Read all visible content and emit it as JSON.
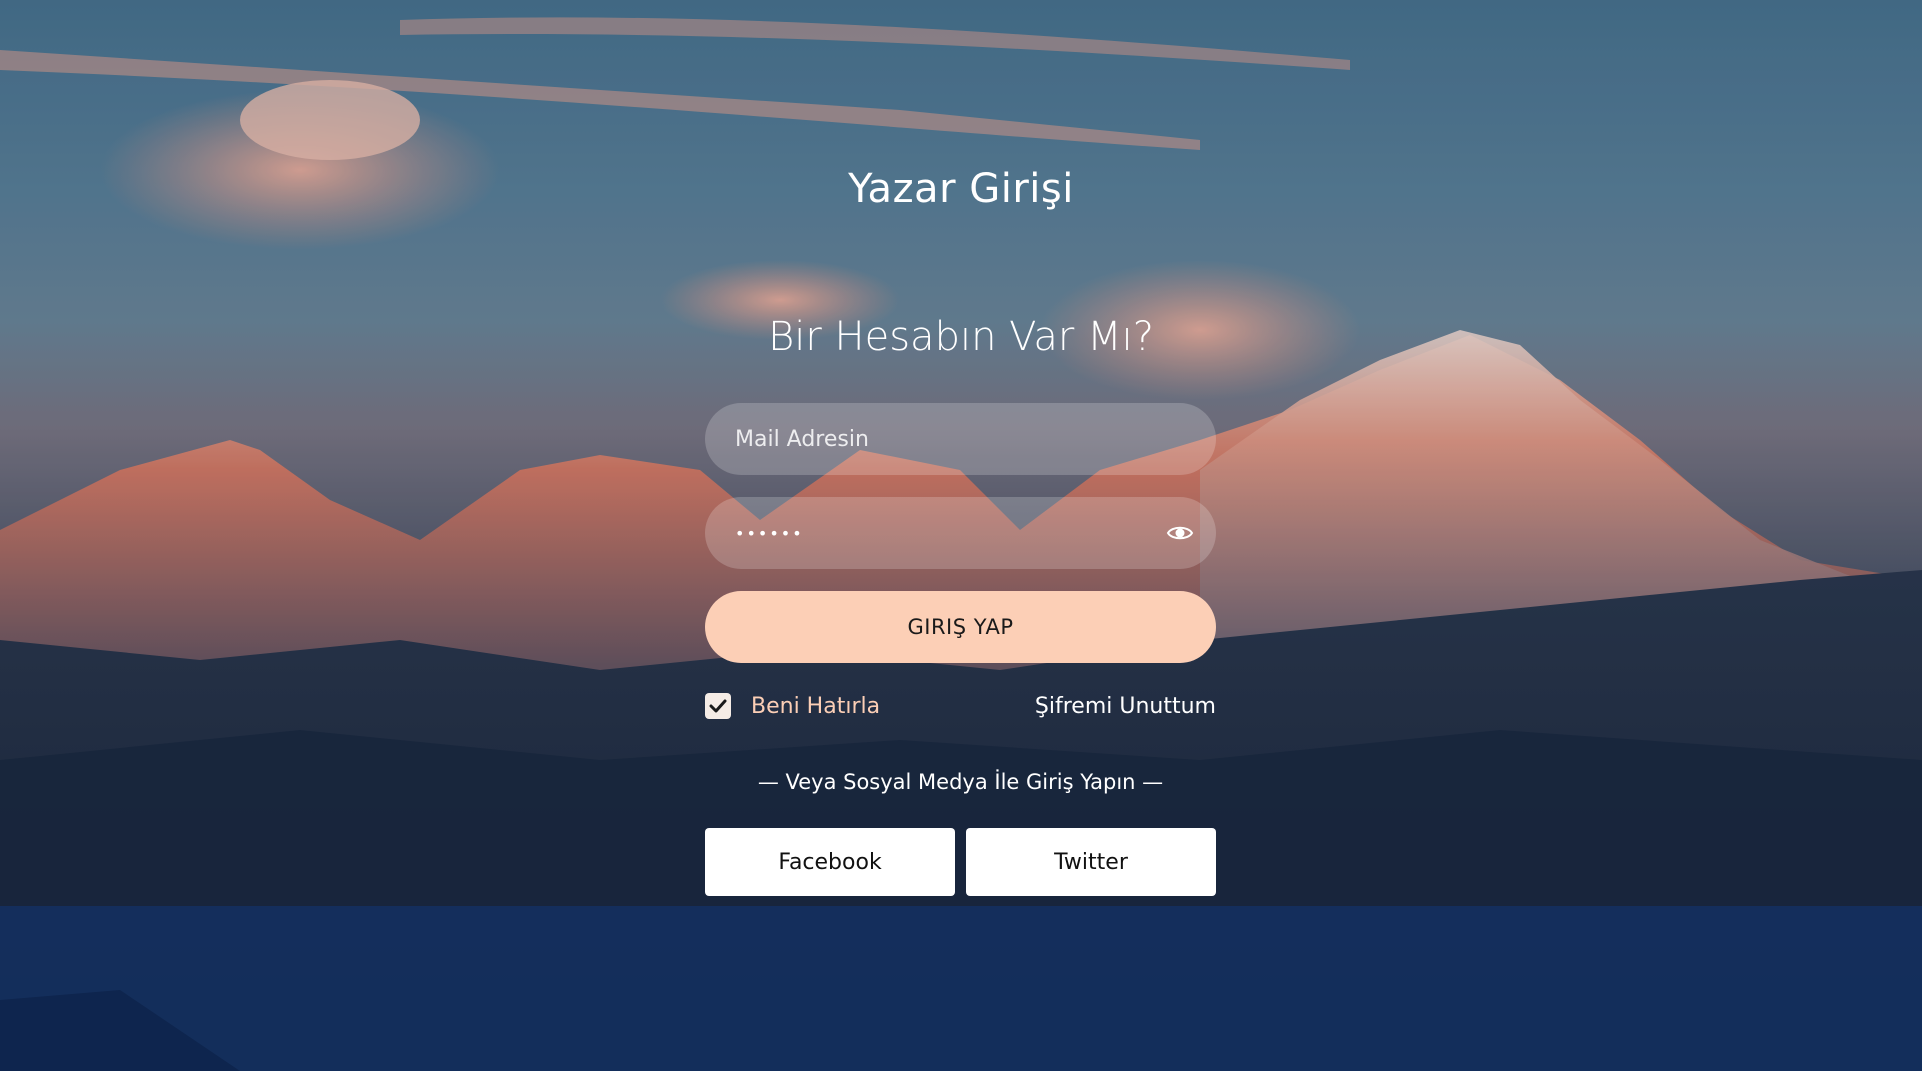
{
  "header": {
    "title": "Yazar Girişi"
  },
  "login": {
    "heading": "Bir Hesabın Var Mı?",
    "email_placeholder": "Mail Adresin",
    "password_value": "******",
    "submit_label": "GIRIŞ YAP",
    "remember_label": "Beni Hatırla",
    "remember_checked": true,
    "forgot_label": "Şifremi Unuttum",
    "social_divider": "— Veya Sosyal Medya İle Giriş Yapın —",
    "social_buttons": [
      {
        "label": "Facebook"
      },
      {
        "label": "Twitter"
      }
    ]
  },
  "colors": {
    "accent": "#fccfb6",
    "text": "#ffffff",
    "button_text": "#1a1a1a"
  },
  "icons": {
    "password_toggle": "eye-icon",
    "checkbox": "check-icon"
  }
}
